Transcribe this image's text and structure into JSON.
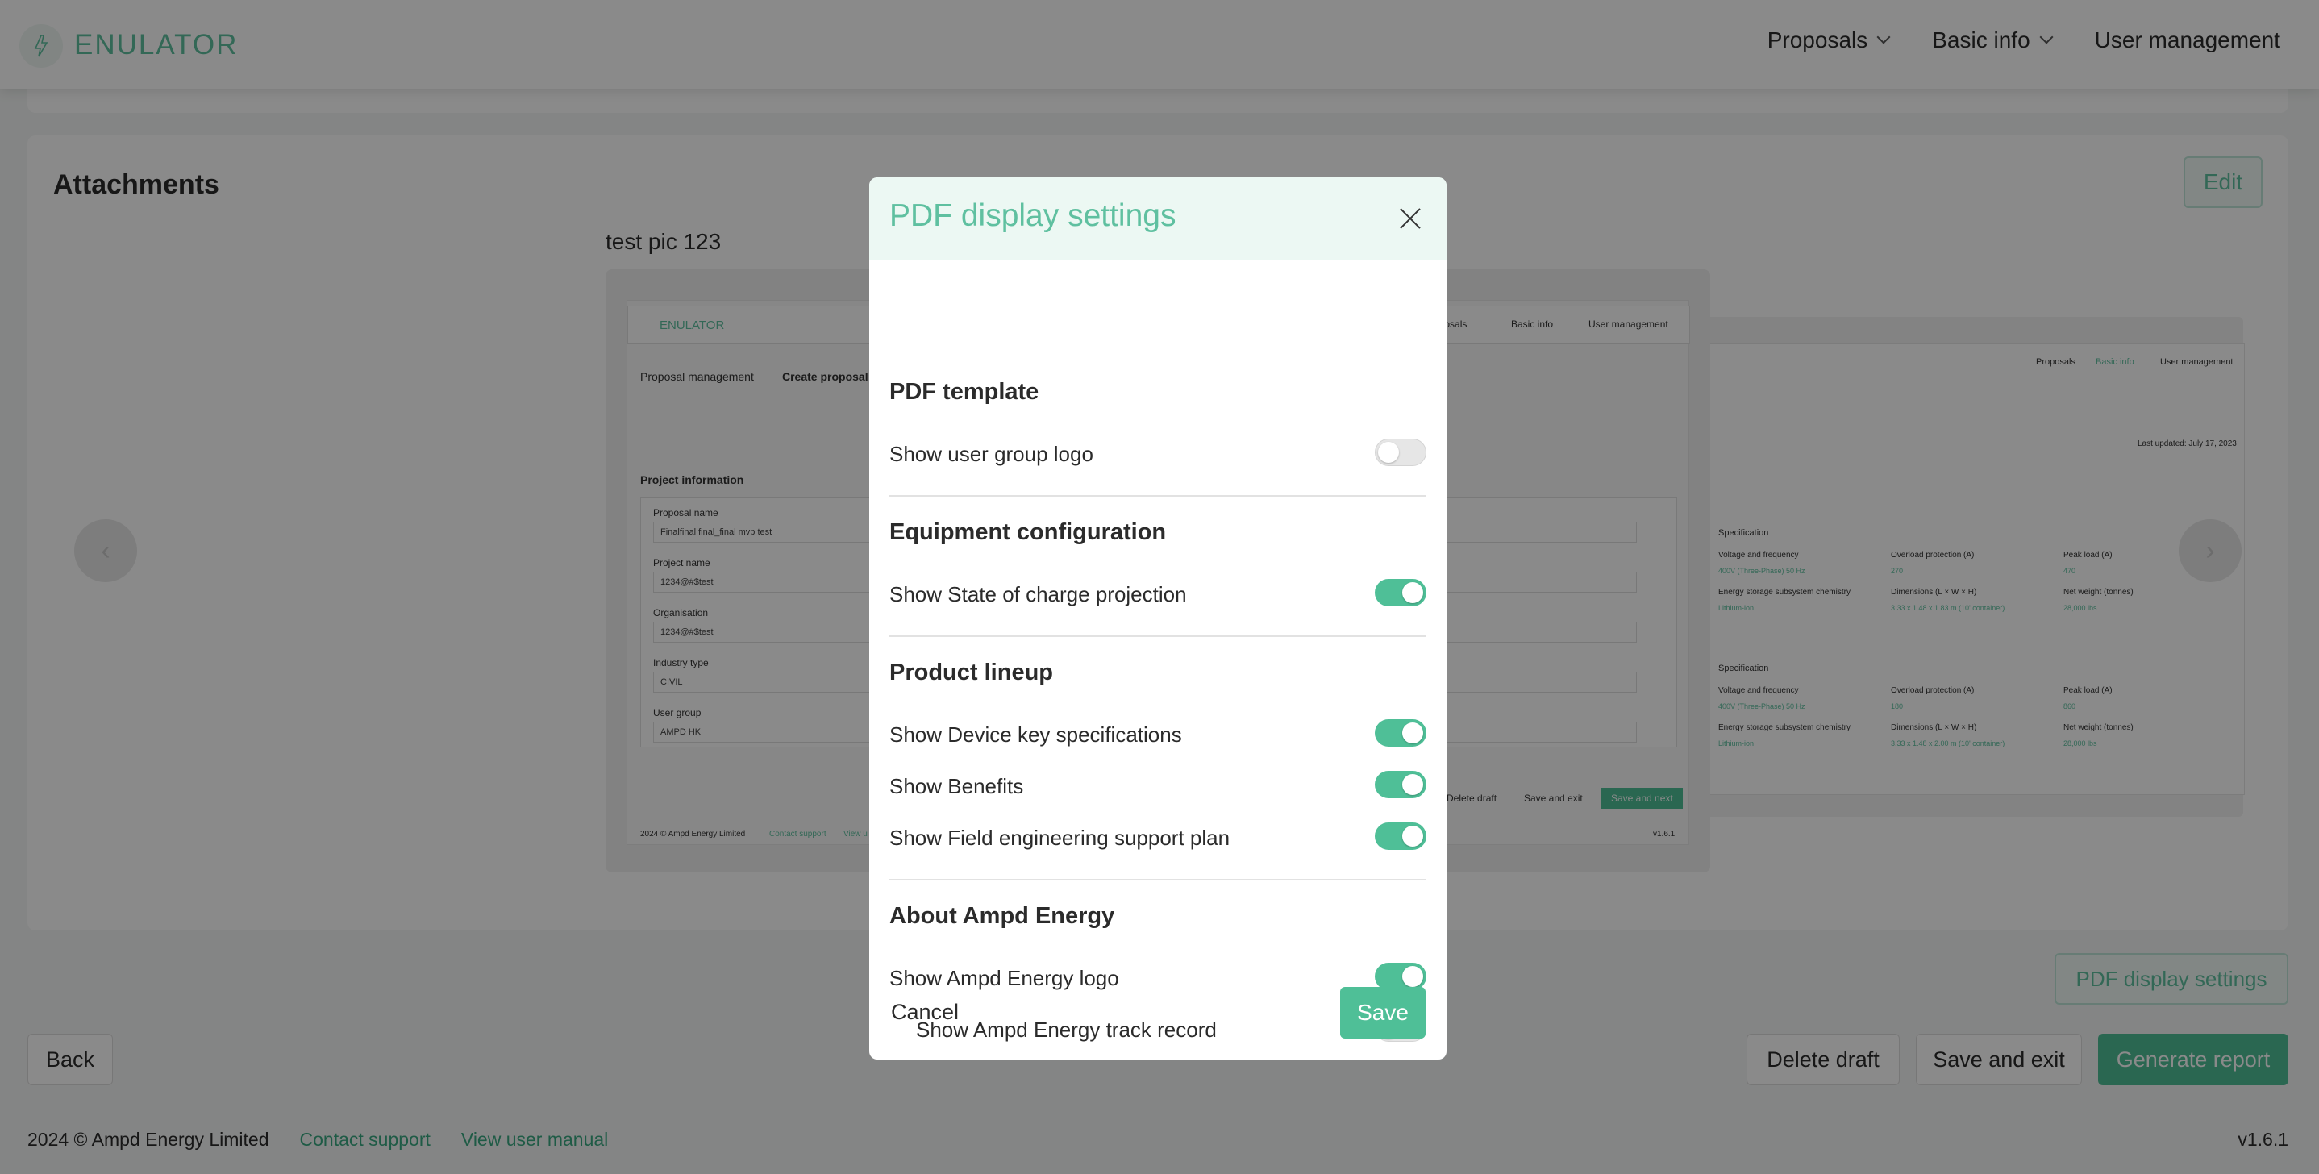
{
  "header": {
    "brand": "ENULATOR",
    "nav": [
      {
        "label": "Proposals",
        "has_dropdown": true
      },
      {
        "label": "Basic info",
        "has_dropdown": true
      },
      {
        "label": "User management",
        "has_dropdown": false
      }
    ]
  },
  "attachments": {
    "title": "Attachments",
    "edit_label": "Edit",
    "caption": "test pic 123",
    "preview": {
      "brand": "ENULATOR",
      "nav": [
        "oposals",
        "Basic info",
        "User management"
      ],
      "breadcrumb": [
        "Proposal management",
        "Create proposal"
      ],
      "section": "Project information",
      "fields": [
        {
          "label": "Proposal name",
          "value": "Finalfinal final_final mvp test"
        },
        {
          "label": "Project name",
          "value": "1234@#$test"
        },
        {
          "label": "Organisation",
          "value": "1234@#$test"
        },
        {
          "label": "Industry type",
          "value": "CIVIL"
        },
        {
          "label": "User group",
          "value": "AMPD HK"
        }
      ],
      "buttons": [
        "Delete draft",
        "Save and exit",
        "Save and next"
      ],
      "footer": [
        "2024 © Ampd Energy Limited",
        "Contact support",
        "View u"
      ],
      "version": "v1.6.1"
    },
    "preview_back": {
      "nav": [
        "Proposals",
        "Basic info",
        "User management"
      ],
      "last_updated": "Last updated: July 17, 2023",
      "specs": [
        {
          "title": "Specification",
          "cols": [
            "Voltage and frequency",
            "Overload protection (A)",
            "Peak load (A)"
          ],
          "vals": [
            "400V (Three-Phase) 50 Hz",
            "270",
            "470"
          ],
          "cols2": [
            "Energy storage subsystem chemistry",
            "Dimensions (L × W × H)",
            "Net weight (tonnes)"
          ],
          "vals2": [
            "Lithium-ion",
            "3.33 x 1.48 x 1.83 m (10' container)",
            "28,000 lbs"
          ]
        },
        {
          "title": "Specification",
          "cols": [
            "Voltage and frequency",
            "Overload protection (A)",
            "Peak load (A)"
          ],
          "vals": [
            "400V (Three-Phase) 50 Hz",
            "180",
            "860"
          ],
          "cols2": [
            "Energy storage subsystem chemistry",
            "Dimensions (L × W × H)",
            "Net weight (tonnes)"
          ],
          "vals2": [
            "Lithium-ion",
            "3.33 x 1.48 x 2.00 m (10' container)",
            "28,000 lbs"
          ]
        }
      ]
    }
  },
  "actions": {
    "pdf_settings_label": "PDF display settings",
    "back_label": "Back",
    "delete_draft_label": "Delete draft",
    "save_exit_label": "Save and exit",
    "generate_label": "Generate report"
  },
  "footer": {
    "copyright": "2024 © Ampd Energy Limited",
    "contact": "Contact support",
    "manual": "View user manual",
    "version": "v1.6.1"
  },
  "modal": {
    "title": "PDF display settings",
    "sections": [
      {
        "title": "PDF template",
        "rows": [
          {
            "label": "Show user group logo",
            "on": false,
            "indent": false
          }
        ]
      },
      {
        "title": "Equipment configuration",
        "rows": [
          {
            "label": "Show State of charge projection",
            "on": true,
            "indent": false
          }
        ]
      },
      {
        "title": "Product lineup",
        "rows": [
          {
            "label": "Show Device key specifications",
            "on": true,
            "indent": false
          },
          {
            "label": "Show Benefits",
            "on": true,
            "indent": false
          },
          {
            "label": "Show Field engineering support plan",
            "on": true,
            "indent": false
          }
        ]
      },
      {
        "title": "About Ampd Energy",
        "rows": [
          {
            "label": "Show Ampd Energy logo",
            "on": true,
            "indent": false
          },
          {
            "label": "Show Ampd Energy track record",
            "on": false,
            "indent": true
          }
        ]
      }
    ],
    "cancel_label": "Cancel",
    "save_label": "Save"
  },
  "colors": {
    "accent": "#4fbf97",
    "accent_text": "#5fc0a0",
    "overlay": "rgba(0,0,0,0.46)"
  }
}
